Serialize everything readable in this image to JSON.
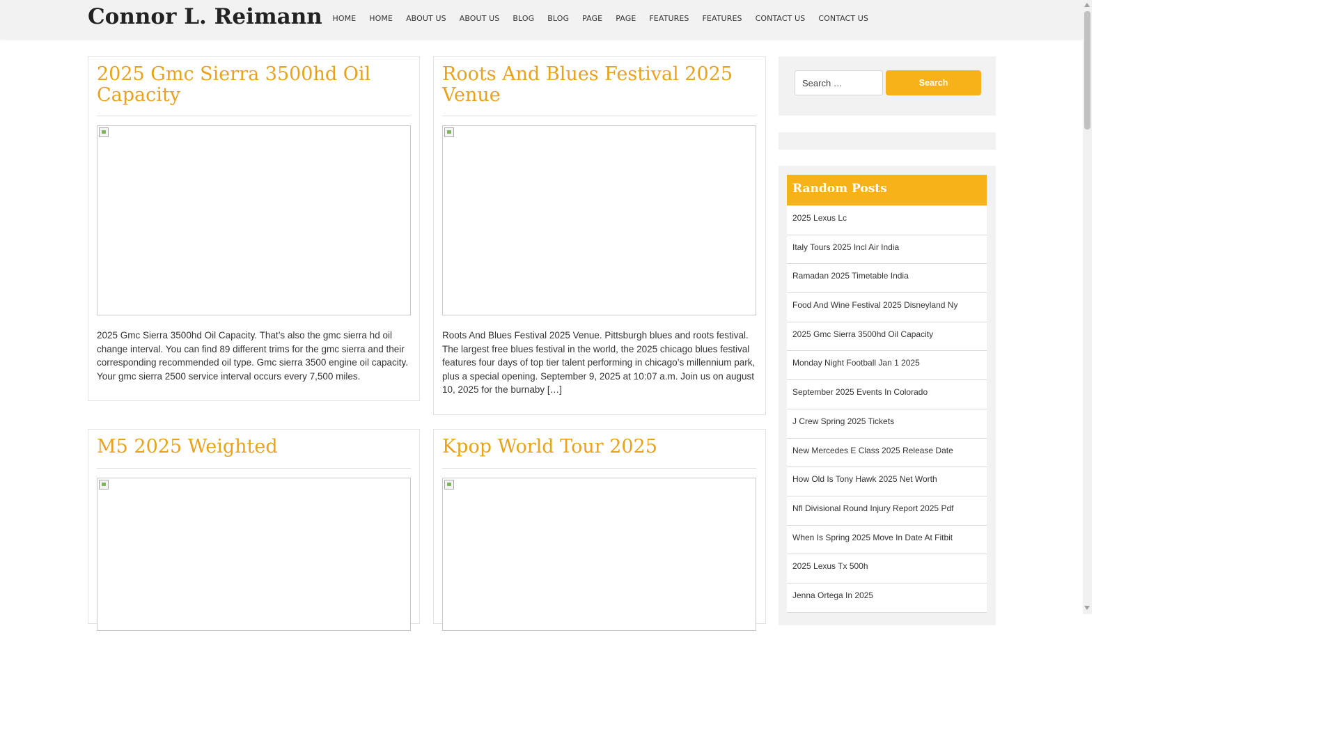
{
  "site": {
    "title": "Connor L. Reimann"
  },
  "nav": [
    "HOME",
    "HOME",
    "ABOUT US",
    "ABOUT US",
    "BLOG",
    "BLOG",
    "PAGE",
    "PAGE",
    "FEATURES",
    "FEATURES",
    "CONTACT US",
    "CONTACT US"
  ],
  "posts": [
    {
      "title": "2025 Gmc Sierra 3500hd Oil Capacity",
      "excerpt": "2025 Gmc Sierra 3500hd Oil Capacity. That’s also the gmc sierra hd oil change interval. You can find 89 different trims for the gmc sierra and their corresponding recommended oil type. Gmc sierra 3500 engine oil capacity. Your gmc sierra 2500 service interval occurs every 7,500 miles."
    },
    {
      "title": "Roots And Blues Festival 2025 Venue",
      "excerpt": "Roots And Blues Festival 2025 Venue. Pittsburgh blues and roots festival. The largest free blues festival in the world, the 2025 chicago blues festival features four days of top tier talent performing in chicago’s millennium park, plus a special opening. September 9, 2025 at 10:07 a.m. Join us on august 10, 2025 for the burnaby […]"
    },
    {
      "title": "M5 2025 Weighted",
      "excerpt": ""
    },
    {
      "title": "Kpop World Tour 2025",
      "excerpt": ""
    }
  ],
  "search": {
    "placeholder": "Search …",
    "button_label": "Search"
  },
  "random_posts": {
    "heading": "Random Posts",
    "items": [
      "2025 Lexus Lc",
      "Italy Tours 2025 Incl Air India",
      "Ramadan 2025 Timetable India",
      "Food And Wine Festival 2025 Disneyland Ny",
      "2025 Gmc Sierra 3500hd Oil Capacity",
      "Monday Night Football Jan 1 2025",
      "September 2025 Events In Colorado",
      "J Crew Spring 2025 Tickets",
      "New Mercedes E Class 2025 Release Date",
      "How Old Is Tony Hawk 2025 Net Worth",
      "Nfl Divisional Round Injury Report 2025 Pdf",
      "When Is Spring 2025 Move In Date At Fitbit",
      "2025 Lexus Tx 500h",
      "Jenna Ortega In 2025"
    ]
  },
  "colors": {
    "accent": "#f7b219",
    "title_accent": "#e8a21c"
  }
}
